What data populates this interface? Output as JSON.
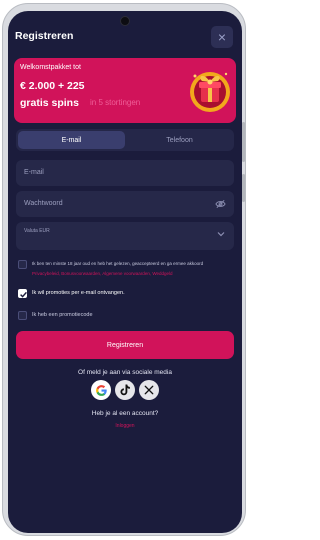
{
  "header": {
    "title": "Registreren",
    "close_icon": "×"
  },
  "banner": {
    "line1": "Welkomstpakket tot",
    "line2": "€ 2.000 + 225",
    "line3": "gratis spins",
    "line4": "in 5 stortingen",
    "image": "gift-box-illustration"
  },
  "tabs": [
    {
      "label": "E-mail",
      "active": true
    },
    {
      "label": "Telefoon",
      "active": false
    }
  ],
  "form": {
    "email_placeholder": "E-mail",
    "password_placeholder": "Wachtwoord",
    "currency_label": "Valuta EUR",
    "currency_value": ""
  },
  "checkboxes": {
    "terms_text": "Ik ben ten minste 18 jaar oud en heb het gelezen, geaccepteerd en ga ermee akkoord",
    "terms_links": "Privacybeleid, Bonusvoorwaarden, Algemene voorwaarden, Weddgeld",
    "promo_label": "Ik wil promoties per e-mail ontvangen.",
    "promo_checked": true,
    "promocode_label": "Ik heb een promotiecode",
    "promocode_checked": false
  },
  "register_button": "Registreren",
  "social": {
    "title": "Of meld je aan via sociale media",
    "providers": [
      "google-icon",
      "tiktok-icon",
      "x-icon"
    ]
  },
  "account_question": "Heb je al een account?",
  "login_link": "Inloggen",
  "colors": {
    "background": "#1b1c3c",
    "field": "#262849",
    "accent": "#d1135a"
  }
}
